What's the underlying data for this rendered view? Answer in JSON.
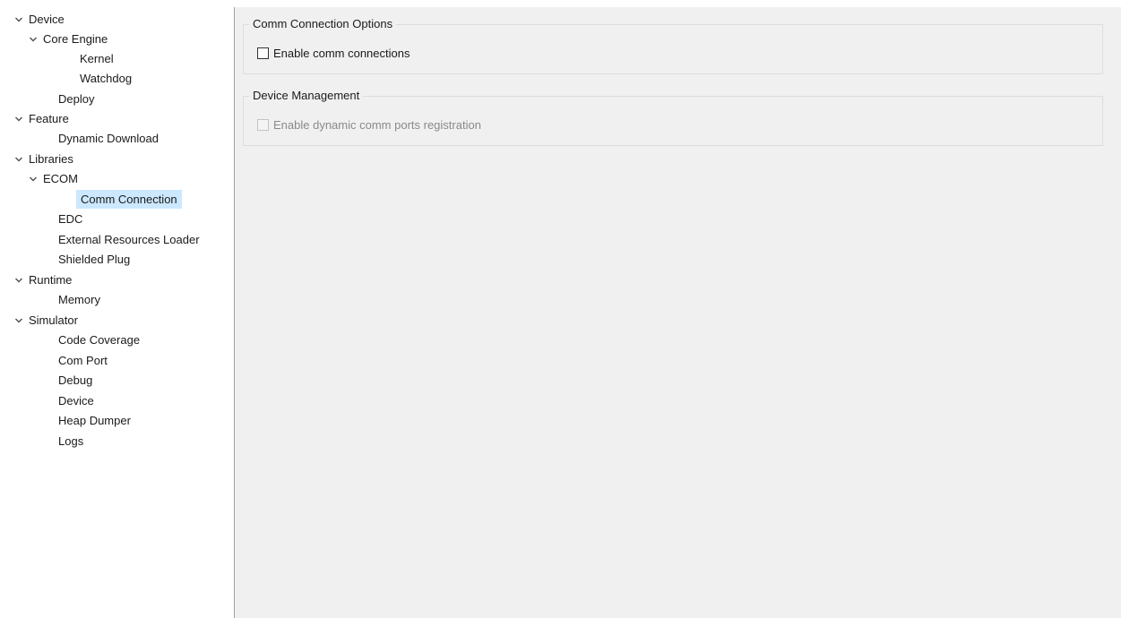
{
  "tree": {
    "items": [
      {
        "label": "Device",
        "expanded": true
      },
      {
        "label": "Core Engine",
        "expanded": true
      },
      {
        "label": "Kernel"
      },
      {
        "label": "Watchdog"
      },
      {
        "label": "Deploy"
      },
      {
        "label": "Feature",
        "expanded": true
      },
      {
        "label": "Dynamic Download"
      },
      {
        "label": "Libraries",
        "expanded": true
      },
      {
        "label": "ECOM",
        "expanded": true
      },
      {
        "label": "Comm Connection",
        "selected": true
      },
      {
        "label": "EDC"
      },
      {
        "label": "External Resources Loader"
      },
      {
        "label": "Shielded Plug"
      },
      {
        "label": "Runtime",
        "expanded": true
      },
      {
        "label": "Memory"
      },
      {
        "label": "Simulator",
        "expanded": true
      },
      {
        "label": "Code Coverage"
      },
      {
        "label": "Com Port"
      },
      {
        "label": "Debug"
      },
      {
        "label": "Device"
      },
      {
        "label": "Heap Dumper"
      },
      {
        "label": "Logs"
      }
    ]
  },
  "groups": {
    "comm_options": {
      "title": "Comm Connection Options",
      "checkbox_label": "Enable comm connections",
      "checked": false
    },
    "device_management": {
      "title": "Device Management",
      "checkbox_label": "Enable dynamic comm ports registration",
      "checked": false,
      "disabled": true
    }
  },
  "colors": {
    "selection": "#cce8ff",
    "panel_bg": "#f0f0f0",
    "disabled_text": "#8a8a8a"
  }
}
